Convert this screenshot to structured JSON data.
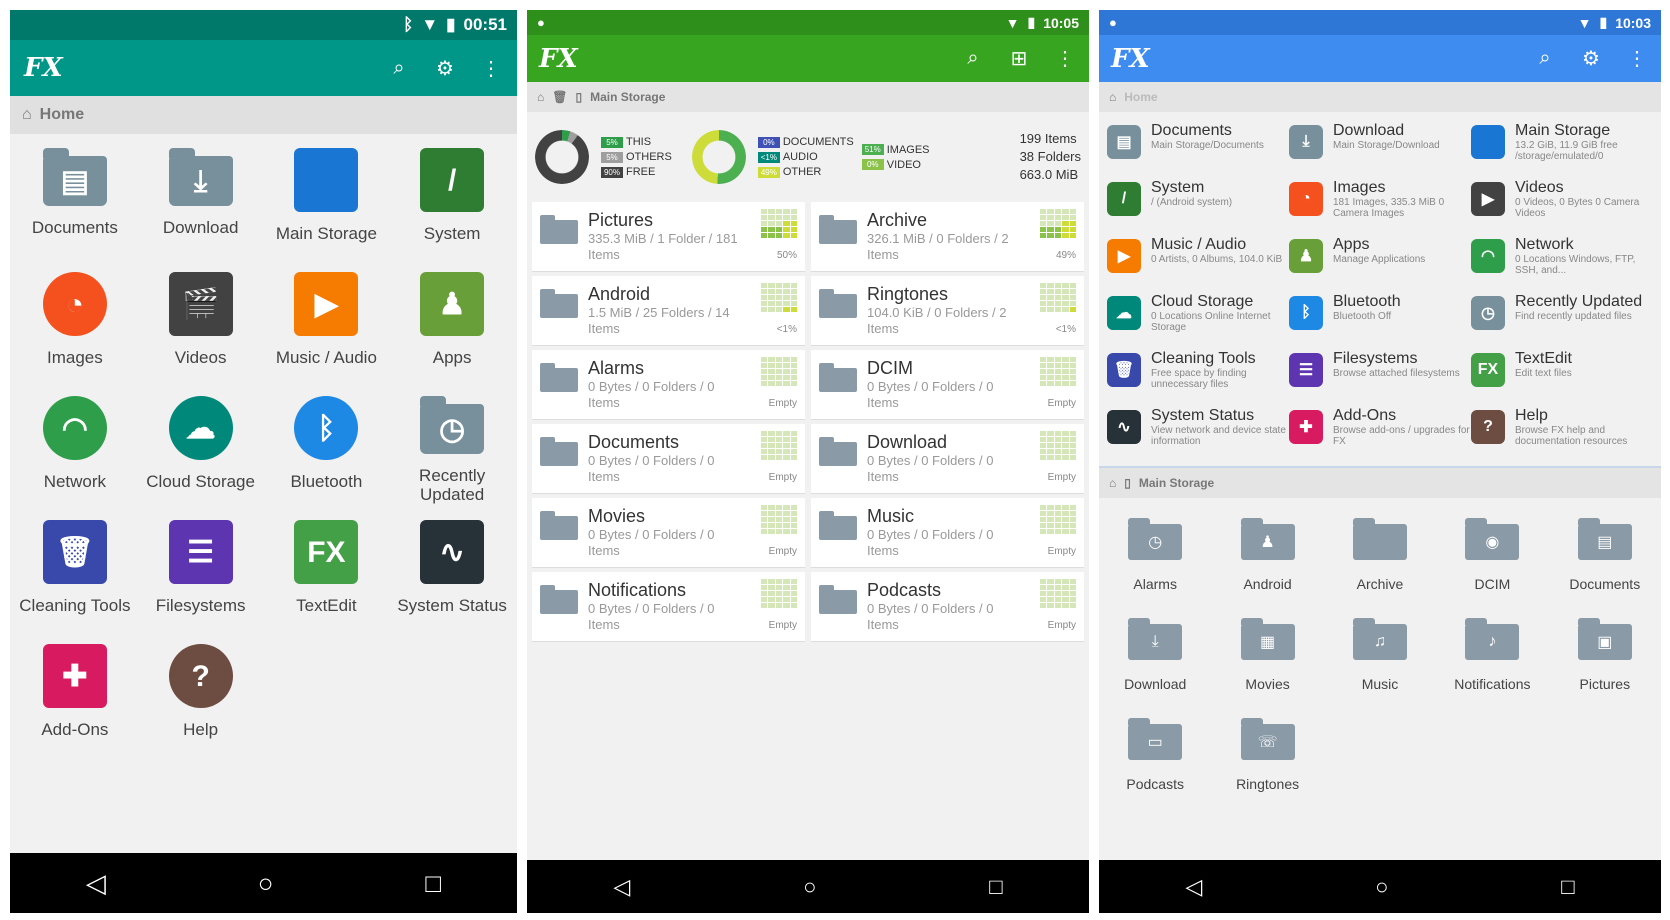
{
  "p1": {
    "time": "00:51",
    "logo": "FX",
    "breadcrumb": "Home",
    "items": [
      {
        "label": "Documents",
        "icon": "documents-folder-icon",
        "color": "#78909c",
        "shape": "fold",
        "glyph": "▤"
      },
      {
        "label": "Download",
        "icon": "download-folder-icon",
        "color": "#78909c",
        "shape": "fold",
        "glyph": "⤓"
      },
      {
        "label": "Main Storage",
        "icon": "main-storage-icon",
        "color": "#1976d2",
        "shape": "sq",
        "glyph": ""
      },
      {
        "label": "System",
        "icon": "system-icon",
        "color": "#2e7d32",
        "shape": "sq",
        "glyph": "/"
      },
      {
        "label": "Images",
        "icon": "images-icon",
        "color": "#f4511e",
        "shape": "rnd",
        "glyph": "◔"
      },
      {
        "label": "Videos",
        "icon": "videos-icon",
        "color": "#424242",
        "shape": "sq",
        "glyph": "🎬"
      },
      {
        "label": "Music / Audio",
        "icon": "music-icon",
        "color": "#f57c00",
        "shape": "sq",
        "glyph": "▶"
      },
      {
        "label": "Apps",
        "icon": "apps-icon",
        "color": "#689f38",
        "shape": "sq",
        "glyph": "♟"
      },
      {
        "label": "Network",
        "icon": "network-icon",
        "color": "#2e9e4a",
        "shape": "rnd",
        "glyph": "◠"
      },
      {
        "label": "Cloud Storage",
        "icon": "cloud-icon",
        "color": "#00897b",
        "shape": "rnd",
        "glyph": "☁"
      },
      {
        "label": "Bluetooth",
        "icon": "bluetooth-icon",
        "color": "#1e88e5",
        "shape": "rnd",
        "glyph": "ᛒ"
      },
      {
        "label": "Recently Updated",
        "icon": "recently-updated-icon",
        "color": "#78909c",
        "shape": "fold",
        "glyph": "◷"
      },
      {
        "label": "Cleaning Tools",
        "icon": "cleaning-tools-icon",
        "color": "#3949ab",
        "shape": "sq",
        "glyph": "🗑"
      },
      {
        "label": "Filesystems",
        "icon": "filesystems-icon",
        "color": "#5e35b1",
        "shape": "sq",
        "glyph": "☰"
      },
      {
        "label": "TextEdit",
        "icon": "textedit-icon",
        "color": "#43a047",
        "shape": "sq",
        "glyph": "FX"
      },
      {
        "label": "System Status",
        "icon": "system-status-icon",
        "color": "#263238",
        "shape": "sq",
        "glyph": "∿"
      },
      {
        "label": "Add-Ons",
        "icon": "addons-icon",
        "color": "#d81b60",
        "shape": "sq",
        "glyph": "✚"
      },
      {
        "label": "Help",
        "icon": "help-icon",
        "color": "#6d4c41",
        "shape": "rnd",
        "glyph": "?"
      }
    ]
  },
  "p2": {
    "time": "10:05",
    "logo": "FX",
    "breadcrumb": "Main Storage",
    "legend1": [
      {
        "pct": "5%",
        "label": "THIS",
        "color": "#2e9e4a"
      },
      {
        "pct": "5%",
        "label": "OTHERS",
        "color": "#9e9e9e"
      },
      {
        "pct": "90%",
        "label": "FREE",
        "color": "#424242"
      }
    ],
    "legend2": [
      {
        "pct": "0%",
        "label": "DOCUMENTS",
        "color": "#3f51b5"
      },
      {
        "pct": "<1%",
        "label": "AUDIO",
        "color": "#00897b"
      },
      {
        "pct": "49%",
        "label": "OTHER",
        "color": "#cddc39"
      }
    ],
    "legend3": [
      {
        "pct": "51%",
        "label": "IMAGES",
        "color": "#4caf50"
      },
      {
        "pct": "0%",
        "label": "VIDEO",
        "color": "#8bc34a"
      }
    ],
    "totals": [
      "199 Items",
      "38 Folders",
      "663.0 MiB"
    ],
    "folders": [
      {
        "name": "Pictures",
        "info": "335.3 MiB / 1 Folder / 181 Items",
        "pct": "50%",
        "fill": 12
      },
      {
        "name": "Archive",
        "info": "326.1 MiB / 0 Folders / 2 Items",
        "pct": "49%",
        "fill": 12
      },
      {
        "name": "Android",
        "info": "1.5 MiB / 25 Folders / 14 Items",
        "pct": "<1%",
        "fill": 2
      },
      {
        "name": "Ringtones",
        "info": "104.0 KiB / 0 Folders / 2 Items",
        "pct": "<1%",
        "fill": 1
      },
      {
        "name": "Alarms",
        "info": "0 Bytes / 0 Folders / 0 Items",
        "pct": "Empty",
        "fill": 0
      },
      {
        "name": "DCIM",
        "info": "0 Bytes / 0 Folders / 0 Items",
        "pct": "Empty",
        "fill": 0
      },
      {
        "name": "Documents",
        "info": "0 Bytes / 0 Folders / 0 Items",
        "pct": "Empty",
        "fill": 0
      },
      {
        "name": "Download",
        "info": "0 Bytes / 0 Folders / 0 Items",
        "pct": "Empty",
        "fill": 0
      },
      {
        "name": "Movies",
        "info": "0 Bytes / 0 Folders / 0 Items",
        "pct": "Empty",
        "fill": 0
      },
      {
        "name": "Music",
        "info": "0 Bytes / 0 Folders / 0 Items",
        "pct": "Empty",
        "fill": 0
      },
      {
        "name": "Notifications",
        "info": "0 Bytes / 0 Folders / 0 Items",
        "pct": "Empty",
        "fill": 0
      },
      {
        "name": "Podcasts",
        "info": "0 Bytes / 0 Folders / 0 Items",
        "pct": "Empty",
        "fill": 0
      }
    ]
  },
  "p3": {
    "time": "10:03",
    "logo": "FX",
    "breadcrumb": "Home",
    "breadcrumb2": "Main Storage",
    "cats": [
      {
        "name": "Documents",
        "sub": "Main Storage/Documents",
        "color": "#78909c",
        "glyph": "▤"
      },
      {
        "name": "Download",
        "sub": "Main Storage/Download",
        "color": "#78909c",
        "glyph": "⤓"
      },
      {
        "name": "Main Storage",
        "sub": "13.2 GiB, 11.9 GiB free /storage/emulated/0",
        "color": "#1976d2",
        "glyph": ""
      },
      {
        "name": "System",
        "sub": "/ (Android system)",
        "color": "#2e7d32",
        "glyph": "/"
      },
      {
        "name": "Images",
        "sub": "181 Images, 335.3 MiB 0 Camera Images",
        "color": "#f4511e",
        "glyph": "◔"
      },
      {
        "name": "Videos",
        "sub": "0 Videos, 0 Bytes 0 Camera Videos",
        "color": "#424242",
        "glyph": "▶"
      },
      {
        "name": "Music / Audio",
        "sub": "0 Artists, 0 Albums, 104.0 KiB",
        "color": "#f57c00",
        "glyph": "▶"
      },
      {
        "name": "Apps",
        "sub": "Manage Applications",
        "color": "#689f38",
        "glyph": "♟"
      },
      {
        "name": "Network",
        "sub": "0 Locations Windows, FTP, SSH, and...",
        "color": "#2e9e4a",
        "glyph": "◠"
      },
      {
        "name": "Cloud Storage",
        "sub": "0 Locations Online Internet Storage",
        "color": "#00897b",
        "glyph": "☁"
      },
      {
        "name": "Bluetooth",
        "sub": "Bluetooth Off",
        "color": "#1e88e5",
        "glyph": "ᛒ"
      },
      {
        "name": "Recently Updated",
        "sub": "Find recently updated files",
        "color": "#78909c",
        "glyph": "◷"
      },
      {
        "name": "Cleaning Tools",
        "sub": "Free space by finding unnecessary files",
        "color": "#3949ab",
        "glyph": "🗑"
      },
      {
        "name": "Filesystems",
        "sub": "Browse attached filesystems",
        "color": "#5e35b1",
        "glyph": "☰"
      },
      {
        "name": "TextEdit",
        "sub": "Edit text files",
        "color": "#43a047",
        "glyph": "FX"
      },
      {
        "name": "System Status",
        "sub": "View network and device state information",
        "color": "#263238",
        "glyph": "∿"
      },
      {
        "name": "Add-Ons",
        "sub": "Browse add-ons / upgrades for FX",
        "color": "#d81b60",
        "glyph": "✚"
      },
      {
        "name": "Help",
        "sub": "Browse FX help and documentation resources",
        "color": "#6d4c41",
        "glyph": "?"
      }
    ],
    "folders": [
      {
        "name": "Alarms",
        "glyph": "◷"
      },
      {
        "name": "Android",
        "glyph": "♟"
      },
      {
        "name": "Archive",
        "glyph": ""
      },
      {
        "name": "DCIM",
        "glyph": "◉"
      },
      {
        "name": "Documents",
        "glyph": "▤"
      },
      {
        "name": "Download",
        "glyph": "⤓"
      },
      {
        "name": "Movies",
        "glyph": "▦"
      },
      {
        "name": "Music",
        "glyph": "♫"
      },
      {
        "name": "Notifications",
        "glyph": "♪"
      },
      {
        "name": "Pictures",
        "glyph": "▣"
      },
      {
        "name": "Podcasts",
        "glyph": "▭"
      },
      {
        "name": "Ringtones",
        "glyph": "☏"
      }
    ]
  }
}
